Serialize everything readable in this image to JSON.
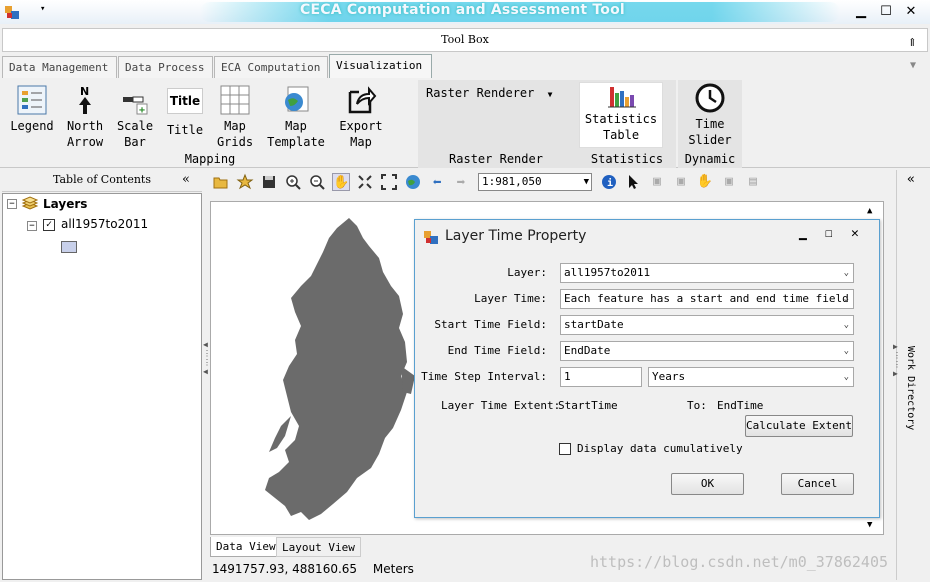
{
  "window": {
    "title": "CECA Computation and Assessment Tool"
  },
  "toolbox": {
    "title": "Tool Box"
  },
  "tabs": [
    {
      "label": "Data Management"
    },
    {
      "label": "Data Process"
    },
    {
      "label": "ECA Computation"
    },
    {
      "label": "Visualization"
    }
  ],
  "ribbon": {
    "mapping": {
      "group_label": "Mapping",
      "buttons": [
        {
          "label1": "Legend",
          "label2": ""
        },
        {
          "label1": "North",
          "label2": "Arrow"
        },
        {
          "label1": "Scale",
          "label2": "Bar"
        },
        {
          "label1": "Title",
          "label2": ""
        },
        {
          "label1": "Map",
          "label2": "Grids"
        },
        {
          "label1": "Map",
          "label2": "Template"
        },
        {
          "label1": "Export",
          "label2": "Map"
        }
      ],
      "title_icon_text": "Title"
    },
    "raster": {
      "dropdown_label": "Raster Renderer",
      "group_label": "Raster Render"
    },
    "statistics": {
      "button1": "Statistics",
      "button2": "Table",
      "group_label": "Statistics"
    },
    "dynamic": {
      "button1": "Time",
      "button2": "Slider",
      "group_label": "Dynamic"
    }
  },
  "toc": {
    "header": "Table of Contents",
    "root": "Layers",
    "layer": "all1957to2011"
  },
  "map_toolbar": {
    "scale": "1:981,050"
  },
  "dialog": {
    "title": "Layer Time Property",
    "fields": {
      "layer_label": "Layer:",
      "layer_value": "all1957to2011",
      "layer_time_label": "Layer Time:",
      "layer_time_value": "Each feature has a start and end time field",
      "start_field_label": "Start Time Field:",
      "start_field_value": "startDate",
      "end_field_label": "End Time Field:",
      "end_field_value": "EndDate",
      "interval_label": "Time Step Interval:",
      "interval_value": "1",
      "interval_unit": "Years",
      "extent_label": "Layer Time Extent:",
      "extent_start": "StartTime",
      "extent_to": "To:",
      "extent_end": "EndTime"
    },
    "calc_button": "Calculate Extent",
    "cumulative_label": "Display data cumulatively",
    "ok_button": "OK",
    "cancel_button": "Cancel"
  },
  "bottom_tabs": [
    {
      "label": "Data View"
    },
    {
      "label": "Layout View"
    }
  ],
  "status": {
    "coords": "1491757.93, 488160.65",
    "units": "Meters"
  },
  "right_panel": {
    "label": "Work Directory"
  },
  "watermark": "https://blog.csdn.net/m0_37862405",
  "colors": {
    "accent": "#5aa0d0",
    "map_feature": "#6b6b6b",
    "title_glow": "#3cc8e6"
  }
}
